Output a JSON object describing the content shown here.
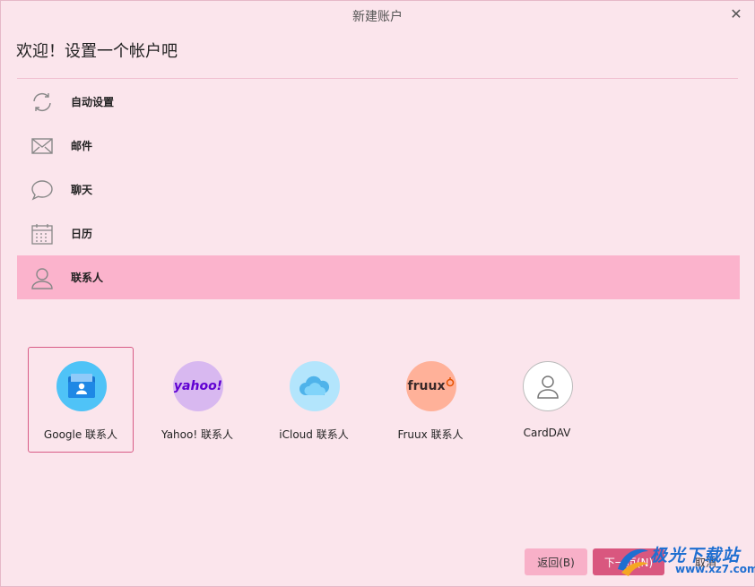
{
  "window": {
    "title": "新建账户"
  },
  "heading": "欢迎！设置一个帐户吧",
  "categories": [
    {
      "label": "自动设置",
      "icon": "sync-icon",
      "selected": false
    },
    {
      "label": "邮件",
      "icon": "envelope-icon",
      "selected": false
    },
    {
      "label": "聊天",
      "icon": "chat-bubble-icon",
      "selected": false
    },
    {
      "label": "日历",
      "icon": "calendar-icon",
      "selected": false
    },
    {
      "label": "联系人",
      "icon": "person-icon",
      "selected": true
    }
  ],
  "providers": [
    {
      "label": "Google 联系人",
      "icon": "google-contacts-icon",
      "color": "#4fc3f7",
      "selected": true
    },
    {
      "label": "Yahoo! 联系人",
      "icon": "yahoo-icon",
      "logo_text": "yahoo!",
      "color": "#d8b8f0",
      "selected": false
    },
    {
      "label": "iCloud 联系人",
      "icon": "icloud-icon",
      "color": "#b3e5fc",
      "selected": false
    },
    {
      "label": "Fruux 联系人",
      "icon": "fruux-icon",
      "logo_text": "fruux",
      "color": "#ffb199",
      "selected": false
    },
    {
      "label": "CardDAV",
      "icon": "carddav-person-icon",
      "color": "#ffffff",
      "selected": false
    }
  ],
  "buttons": {
    "back": "返回(B)",
    "next": "下一页(N)",
    "cancel": "取消"
  },
  "watermark": {
    "name": "极光下载站",
    "site": "www.xz7.com"
  }
}
